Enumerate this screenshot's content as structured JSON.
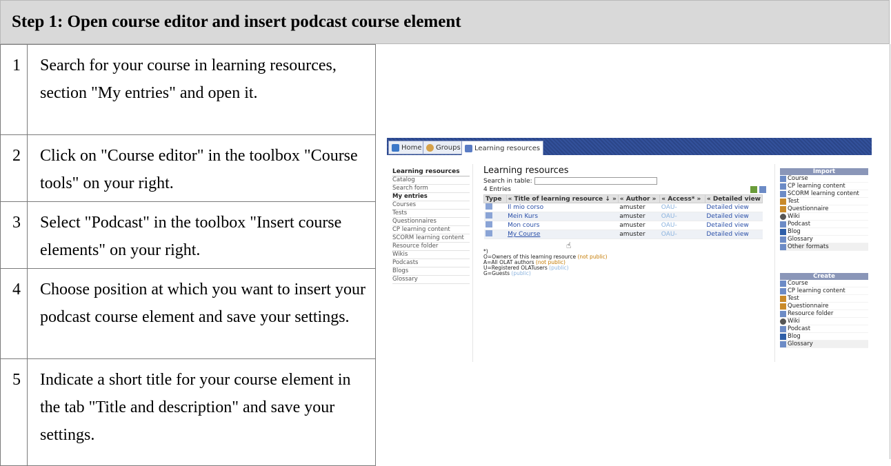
{
  "header": {
    "title": "Step 1: Open course editor and insert podcast course element"
  },
  "steps": [
    {
      "num": "1",
      "text": "Search for your course in learning resources, section \"My entries\" and open it."
    },
    {
      "num": "2",
      "text": "Click on \"Course editor\" in the toolbox \"Course tools\" on your right."
    },
    {
      "num": "3",
      "text": "Select \"Podcast\" in the toolbox \"Insert course elements\" on your right."
    },
    {
      "num": "4",
      "text": "Choose position at which you want to insert your podcast course element and save your settings."
    },
    {
      "num": "5",
      "text": "Indicate a short title for your course element in the tab \"Title and description\" and save your settings."
    }
  ],
  "screenshot": {
    "tabs": [
      "Home",
      "Groups",
      "Learning resources"
    ],
    "nav": [
      "Learning resources",
      "Catalog",
      "Search form",
      "My entries",
      "Courses",
      "Tests",
      "Questionnaires",
      "CP learning content",
      "SCORM learning content",
      "Resource folder",
      "Wikis",
      "Podcasts",
      "Blogs",
      "Glossary"
    ],
    "title": "Learning resources",
    "search_label": "Search in table:",
    "entries": "4 Entries",
    "columns": [
      "Type",
      "« Title of learning resource ↓ »",
      "« Author »",
      "« Access* »",
      "« Detailed view"
    ],
    "rows": [
      {
        "title": "Il mio corso",
        "author": "amuster",
        "access": "OAU-",
        "detail": "Detailed view"
      },
      {
        "title": "Mein Kurs",
        "author": "amuster",
        "access": "OAU-",
        "detail": "Detailed view"
      },
      {
        "title": "Mon cours",
        "author": "amuster",
        "access": "OAU-",
        "detail": "Detailed view"
      },
      {
        "title": "My Course",
        "author": "amuster",
        "access": "OAU-",
        "detail": "Detailed view"
      }
    ],
    "legend": {
      "star": "*)",
      "o": "O=Owners of this learning resource",
      "o_note": "(not public)",
      "a": "A=All OLAT authors",
      "a_note": "(not public)",
      "u": "U=Registered OLATusers",
      "u_note": "(public)",
      "g": "G=Guests",
      "g_note": "(public)"
    },
    "import": {
      "title": "Import",
      "items": [
        "Course",
        "CP learning content",
        "SCORM learning content",
        "Test",
        "Questionnaire",
        "Wiki",
        "Podcast",
        "Blog",
        "Glossary",
        "Other formats"
      ]
    },
    "create": {
      "title": "Create",
      "items": [
        "Course",
        "CP learning content",
        "Test",
        "Questionnaire",
        "Resource folder",
        "Wiki",
        "Podcast",
        "Blog",
        "Glossary"
      ]
    },
    "colors": {
      "tabbar": "#33519b",
      "link": "#2a4fa8",
      "not_public": "#c47a00",
      "public": "#8bb3de"
    }
  }
}
